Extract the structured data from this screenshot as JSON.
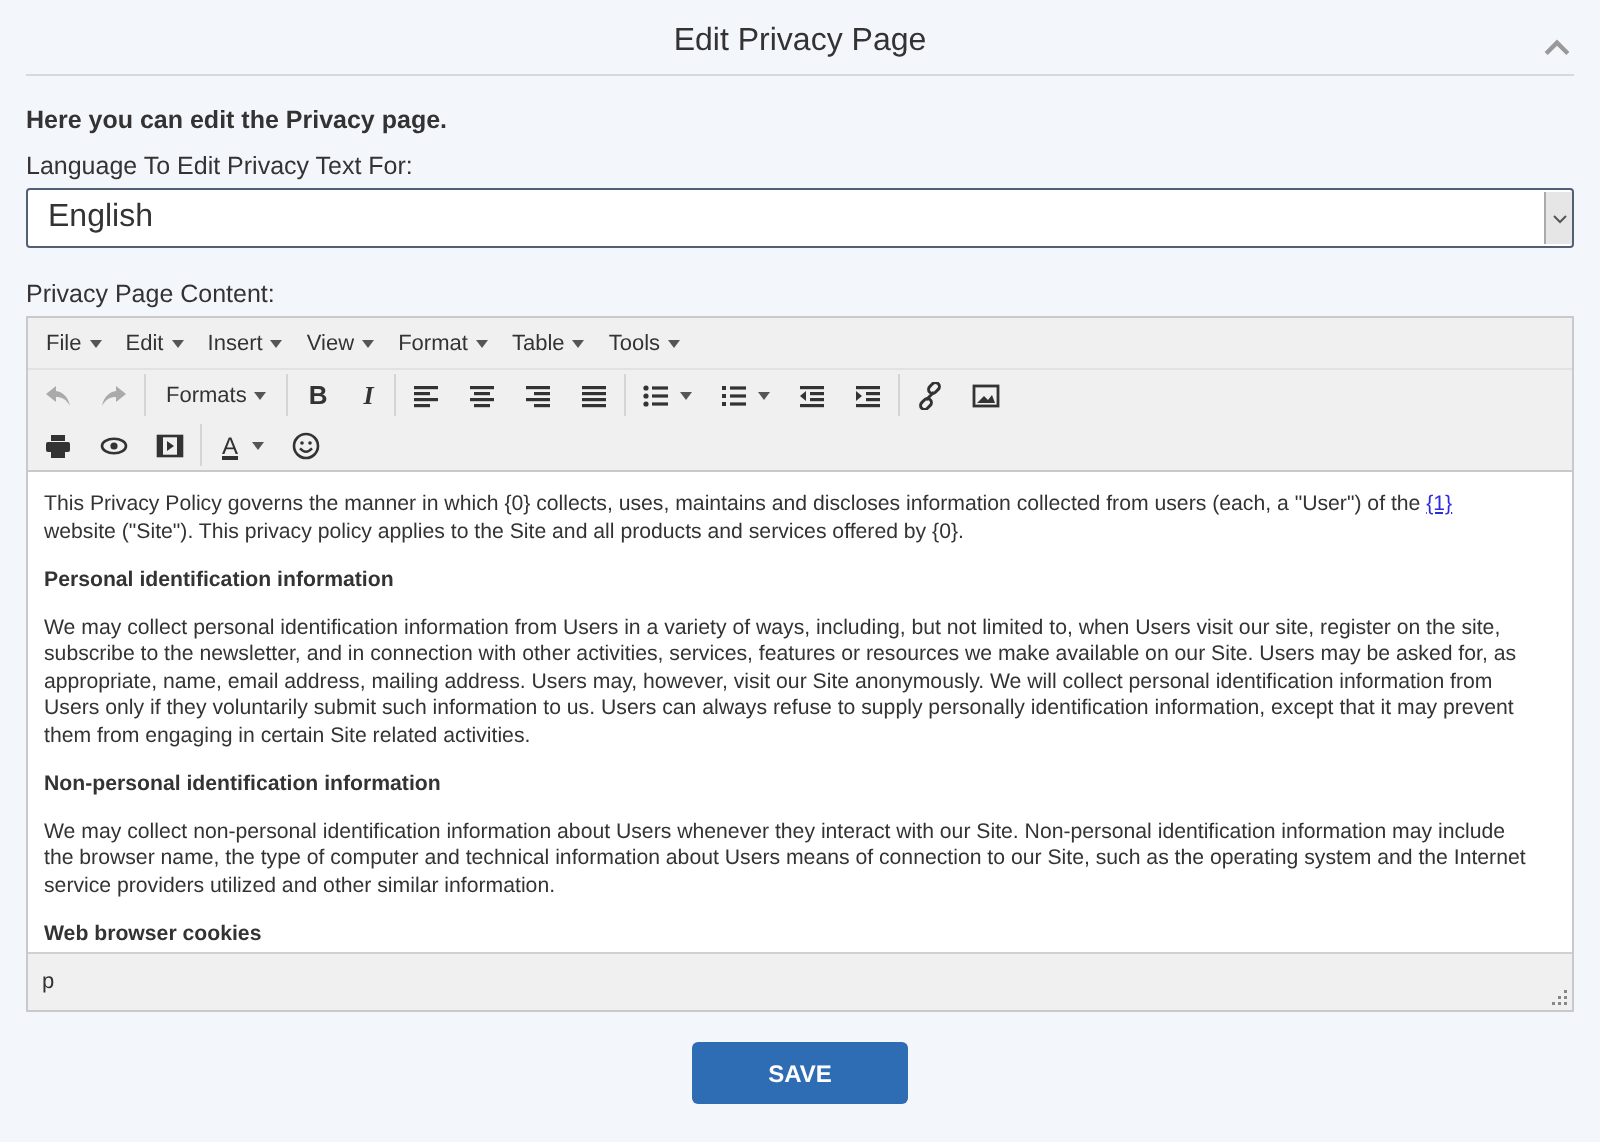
{
  "header": {
    "title": "Edit Privacy Page",
    "expanded": true
  },
  "intro": "Here you can edit the Privacy page.",
  "language_field": {
    "label": "Language To Edit Privacy Text For:",
    "value": "English"
  },
  "content_label": "Privacy Page Content:",
  "editor": {
    "menus": [
      "File",
      "Edit",
      "Insert",
      "View",
      "Format",
      "Table",
      "Tools"
    ],
    "toolbar": {
      "undo": {
        "disabled": true
      },
      "redo": {
        "disabled": true
      },
      "formats": {
        "label": "Formats"
      },
      "bold": {
        "label": "B"
      },
      "italic": {
        "label": "I"
      },
      "text_color": {
        "label": "A"
      }
    },
    "paragraphs": [
      {
        "kind": "text",
        "parts": [
          {
            "kind": "text",
            "text": "This Privacy Policy governs the manner in which {0} collects, uses, maintains and discloses information collected from users (each, a \"User\") of the "
          },
          {
            "kind": "link",
            "text": "{1}"
          },
          {
            "kind": "text",
            "text": " website (\"Site\"). This privacy policy applies to the Site and all products and services offered by {0}."
          }
        ]
      },
      {
        "kind": "heading",
        "parts": [
          {
            "kind": "text",
            "text": "Personal identification information"
          }
        ]
      },
      {
        "kind": "text",
        "parts": [
          {
            "kind": "text",
            "text": "We may collect personal identification information from Users in a variety of ways, including, but not limited to, when Users visit our site, register on the site, subscribe to the newsletter, and in connection with other activities, services, features or resources we make available on our Site. Users may be asked for, as appropriate, name, email address, mailing address. Users may, however, visit our Site anonymously. We will collect personal identification information from Users only if they voluntarily submit such information to us. Users can always refuse to supply personally identification information, except that it may prevent them from engaging in certain Site related activities."
          }
        ]
      },
      {
        "kind": "heading",
        "parts": [
          {
            "kind": "text",
            "text": "Non-personal identification information"
          }
        ]
      },
      {
        "kind": "text",
        "parts": [
          {
            "kind": "text",
            "text": "We may collect non-personal identification information about Users whenever they interact with our Site. Non-personal identification information may include the browser name, the type of computer and technical information about Users means of connection to our Site, such as the operating system and the Internet service providers utilized and other similar information."
          }
        ]
      },
      {
        "kind": "heading",
        "parts": [
          {
            "kind": "text",
            "text": "Web browser cookies"
          }
        ]
      }
    ],
    "status_path": "p"
  },
  "save_button": "SAVE"
}
